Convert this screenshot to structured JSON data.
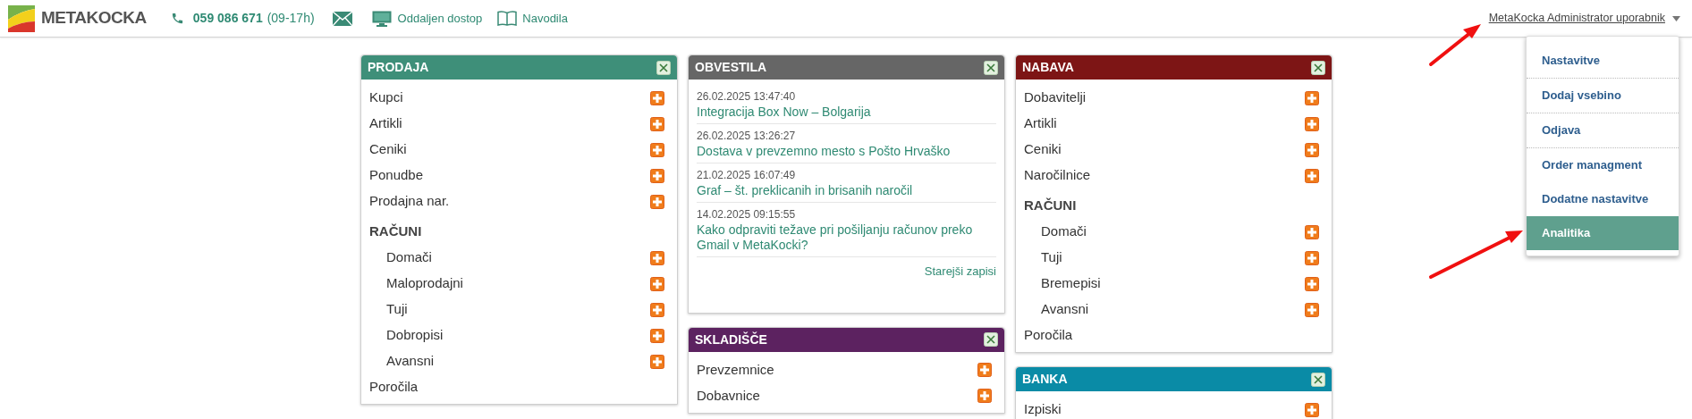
{
  "header": {
    "logo": "METAKOCKA",
    "phone": "059 086 671",
    "hours": "(09-17h)",
    "links": [
      "Oddaljen dostop",
      "Navodila"
    ],
    "user": "MetaKocka Administrator uporabnik"
  },
  "user_menu": {
    "groups": [
      [
        {
          "label": "Nastavitve",
          "selected": false
        }
      ],
      [
        {
          "label": "Dodaj vsebino",
          "selected": false
        }
      ],
      [
        {
          "label": "Odjava",
          "selected": false
        }
      ],
      [
        {
          "label": "Order managment",
          "selected": false
        },
        {
          "label": "Dodatne nastavitve",
          "selected": false
        },
        {
          "label": "Analitika",
          "selected": true
        }
      ]
    ]
  },
  "columns": [
    [
      {
        "kind": "menu",
        "title": "PRODAJA",
        "color": "#3e8f79",
        "items": [
          {
            "kind": "entry",
            "label": "Kupci",
            "add": true
          },
          {
            "kind": "entry",
            "label": "Artikli",
            "add": true
          },
          {
            "kind": "entry",
            "label": "Ceniki",
            "add": true
          },
          {
            "kind": "entry",
            "label": "Ponudbe",
            "add": true
          },
          {
            "kind": "entry",
            "label": "Prodajna nar.",
            "add": true
          },
          {
            "kind": "heading",
            "label": "RAČUNI",
            "children": [
              {
                "kind": "entry",
                "label": "Domači",
                "add": true
              },
              {
                "kind": "entry",
                "label": "Maloprodajni",
                "add": true
              },
              {
                "kind": "entry",
                "label": "Tuji",
                "add": true
              },
              {
                "kind": "entry",
                "label": "Dobropisi",
                "add": true
              },
              {
                "kind": "entry",
                "label": "Avansni",
                "add": true
              }
            ]
          },
          {
            "kind": "entry",
            "label": "Poročila",
            "add": false
          }
        ]
      }
    ],
    [
      {
        "kind": "news",
        "title": "OBVESTILA",
        "color": "#666666",
        "news": [
          {
            "date": "26.02.2025 13:47:40",
            "title": "Integracija Box Now – Bolgarija"
          },
          {
            "date": "26.02.2025 13:26:27",
            "title": "Dostava v prevzemno mesto s Pošto Hrvaško"
          },
          {
            "date": "21.02.2025 16:07:49",
            "title": "Graf – št. preklicanih in brisanih naročil"
          },
          {
            "date": "14.02.2025 09:15:55",
            "title": "Kako odpraviti težave pri pošiljanju računov preko Gmail v MetaKocki?"
          }
        ],
        "more": "Starejši zapisi"
      },
      {
        "kind": "menu",
        "title": "SKLADIŠČE",
        "color": "#5c2260",
        "items": [
          {
            "kind": "entry",
            "label": "Prevzemnice",
            "add": true
          },
          {
            "kind": "entry",
            "label": "Dobavnice",
            "add": true
          }
        ]
      }
    ],
    [
      {
        "kind": "menu",
        "title": "NABAVA",
        "color": "#7d1515",
        "items": [
          {
            "kind": "entry",
            "label": "Dobavitelji",
            "add": true
          },
          {
            "kind": "entry",
            "label": "Artikli",
            "add": true
          },
          {
            "kind": "entry",
            "label": "Ceniki",
            "add": true
          },
          {
            "kind": "entry",
            "label": "Naročilnice",
            "add": true
          },
          {
            "kind": "heading",
            "label": "RAČUNI",
            "children": [
              {
                "kind": "entry",
                "label": "Domači",
                "add": true
              },
              {
                "kind": "entry",
                "label": "Tuji",
                "add": true
              },
              {
                "kind": "entry",
                "label": "Bremepisi",
                "add": true
              },
              {
                "kind": "entry",
                "label": "Avansni",
                "add": true
              }
            ]
          },
          {
            "kind": "entry",
            "label": "Poročila",
            "add": false
          }
        ]
      },
      {
        "kind": "menu",
        "title": "BANKA",
        "color": "#0a8ba6",
        "items": [
          {
            "kind": "entry",
            "label": "Izpiski",
            "add": true
          }
        ]
      }
    ]
  ]
}
